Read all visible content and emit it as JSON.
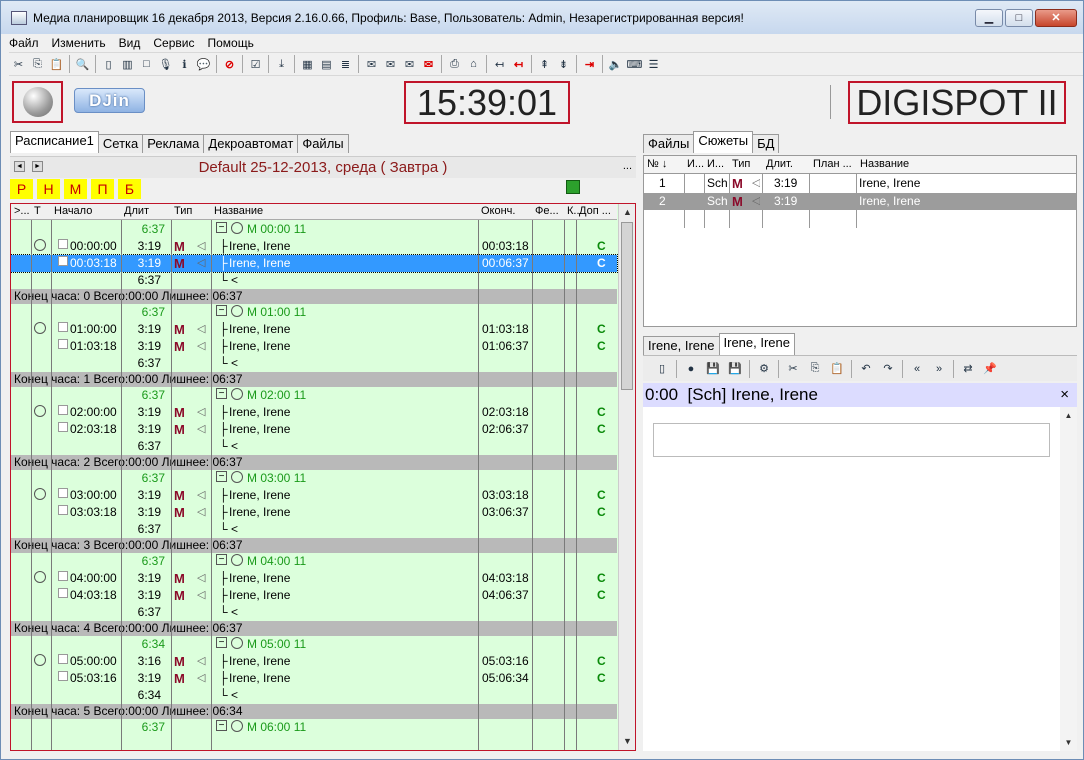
{
  "window": {
    "title": "Медиа планировщик 16 декабря 2013, Версия 2.16.0.66, Профиль: Base, Пользователь: Admin, Незарегистрированная версия!",
    "btn_min": "▁",
    "btn_max": "□",
    "btn_close": "✕"
  },
  "menu": [
    "Файл",
    "Изменить",
    "Вид",
    "Сервис",
    "Помощь"
  ],
  "header": {
    "logo": "DJin",
    "clock": "15:39:01",
    "brand": "DIGISPOT II"
  },
  "left_tabs": [
    "Расписание1",
    "Сетка",
    "Реклама",
    "Декроавтомат",
    "Файлы"
  ],
  "schedule": {
    "title": "Default 25-12-2013, среда ( Завтра )",
    "more": "...",
    "nav_prev": "◄",
    "nav_next": "►"
  },
  "letters": [
    "Р",
    "Н",
    "М",
    "П",
    "Б"
  ],
  "grid_headers": {
    "c0": ">...",
    "c1": "Т",
    "c2": "Начало",
    "c3": "Длит",
    "c4": "Тип",
    "c5": "Название",
    "c6": "Оконч.",
    "c7": "Фе...",
    "c8": "К..",
    "c9": "Доп ..."
  },
  "hours": [
    {
      "group_dur": "6:37",
      "group_name": "M 00:00 11",
      "items": [
        {
          "start": "00:00:00",
          "dur": "3:19",
          "name": "Irene, Irene",
          "end": "00:03:18",
          "extra": "C"
        },
        {
          "start": "00:03:18",
          "dur": "3:19",
          "name": "Irene, Irene",
          "end": "00:06:37",
          "extra": "C"
        }
      ],
      "tail_dur": "6:37",
      "tail_name": "<",
      "footer": "Конец часа: 0 Всего:00:00 Лишнее: 06:37"
    },
    {
      "group_dur": "6:37",
      "group_name": "M 01:00 11",
      "items": [
        {
          "start": "01:00:00",
          "dur": "3:19",
          "name": "Irene, Irene",
          "end": "01:03:18",
          "extra": "C"
        },
        {
          "start": "01:03:18",
          "dur": "3:19",
          "name": "Irene, Irene",
          "end": "01:06:37",
          "extra": "C"
        }
      ],
      "tail_dur": "6:37",
      "tail_name": "<",
      "footer": "Конец часа: 1 Всего:00:00 Лишнее: 06:37"
    },
    {
      "group_dur": "6:37",
      "group_name": "M 02:00 11",
      "items": [
        {
          "start": "02:00:00",
          "dur": "3:19",
          "name": "Irene, Irene",
          "end": "02:03:18",
          "extra": "C"
        },
        {
          "start": "02:03:18",
          "dur": "3:19",
          "name": "Irene, Irene",
          "end": "02:06:37",
          "extra": "C"
        }
      ],
      "tail_dur": "6:37",
      "tail_name": "<",
      "footer": "Конец часа: 2 Всего:00:00 Лишнее: 06:37"
    },
    {
      "group_dur": "6:37",
      "group_name": "M 03:00 11",
      "items": [
        {
          "start": "03:00:00",
          "dur": "3:19",
          "name": "Irene, Irene",
          "end": "03:03:18",
          "extra": "C"
        },
        {
          "start": "03:03:18",
          "dur": "3:19",
          "name": "Irene, Irene",
          "end": "03:06:37",
          "extra": "C"
        }
      ],
      "tail_dur": "6:37",
      "tail_name": "<",
      "footer": "Конец часа: 3 Всего:00:00 Лишнее: 06:37"
    },
    {
      "group_dur": "6:37",
      "group_name": "M 04:00 11",
      "items": [
        {
          "start": "04:00:00",
          "dur": "3:19",
          "name": "Irene, Irene",
          "end": "04:03:18",
          "extra": "C"
        },
        {
          "start": "04:03:18",
          "dur": "3:19",
          "name": "Irene, Irene",
          "end": "04:06:37",
          "extra": "C"
        }
      ],
      "tail_dur": "6:37",
      "tail_name": "<",
      "footer": "Конец часа: 4 Всего:00:00 Лишнее: 06:37"
    },
    {
      "group_dur": "6:34",
      "group_name": "M 05:00 11",
      "items": [
        {
          "start": "05:00:00",
          "dur": "3:16",
          "name": "Irene, Irene",
          "end": "05:03:16",
          "extra": "C"
        },
        {
          "start": "05:03:16",
          "dur": "3:19",
          "name": "Irene, Irene",
          "end": "05:06:34",
          "extra": "C"
        }
      ],
      "tail_dur": "6:34",
      "tail_name": "<",
      "footer": "Конец часа: 5 Всего:00:00 Лишнее: 06:34"
    },
    {
      "group_dur": "6:37",
      "group_name": "M 06:00 11",
      "items": [],
      "tail_dur": "",
      "tail_name": "",
      "footer": ""
    }
  ],
  "right_tabs": [
    "Файлы",
    "Сюжеты",
    "БД"
  ],
  "right_headers": {
    "h0": "№",
    "h1": "И...",
    "h2": "И...",
    "h3": "Тип",
    "h4": "Длит.",
    "h5": "План ...",
    "h6": "Название"
  },
  "right_rows": [
    {
      "num": "1",
      "code": "Sch",
      "dur": "3:19",
      "name": "Irene, Irene"
    },
    {
      "num": "2",
      "code": "Sch",
      "dur": "3:19",
      "name": "Irene, Irene"
    }
  ],
  "bottom_tabs": [
    "Irene, Irene",
    "Irene, Irene"
  ],
  "info": {
    "time": "0:00",
    "text": "[Sch] Irene, Irene",
    "close": "×"
  },
  "icons": {
    "mark": "M",
    "speaker": "◁",
    "clock": "clock-icon",
    "sort": "↓",
    "separator": "",
    "branch_mid": "├",
    "branch_end": "└",
    "expand": "−"
  },
  "colors": {
    "accent_red": "#c0142a",
    "grid_bg": "#dcffdc",
    "green_text": "#1a9a1a",
    "selection": "#3399ff"
  }
}
